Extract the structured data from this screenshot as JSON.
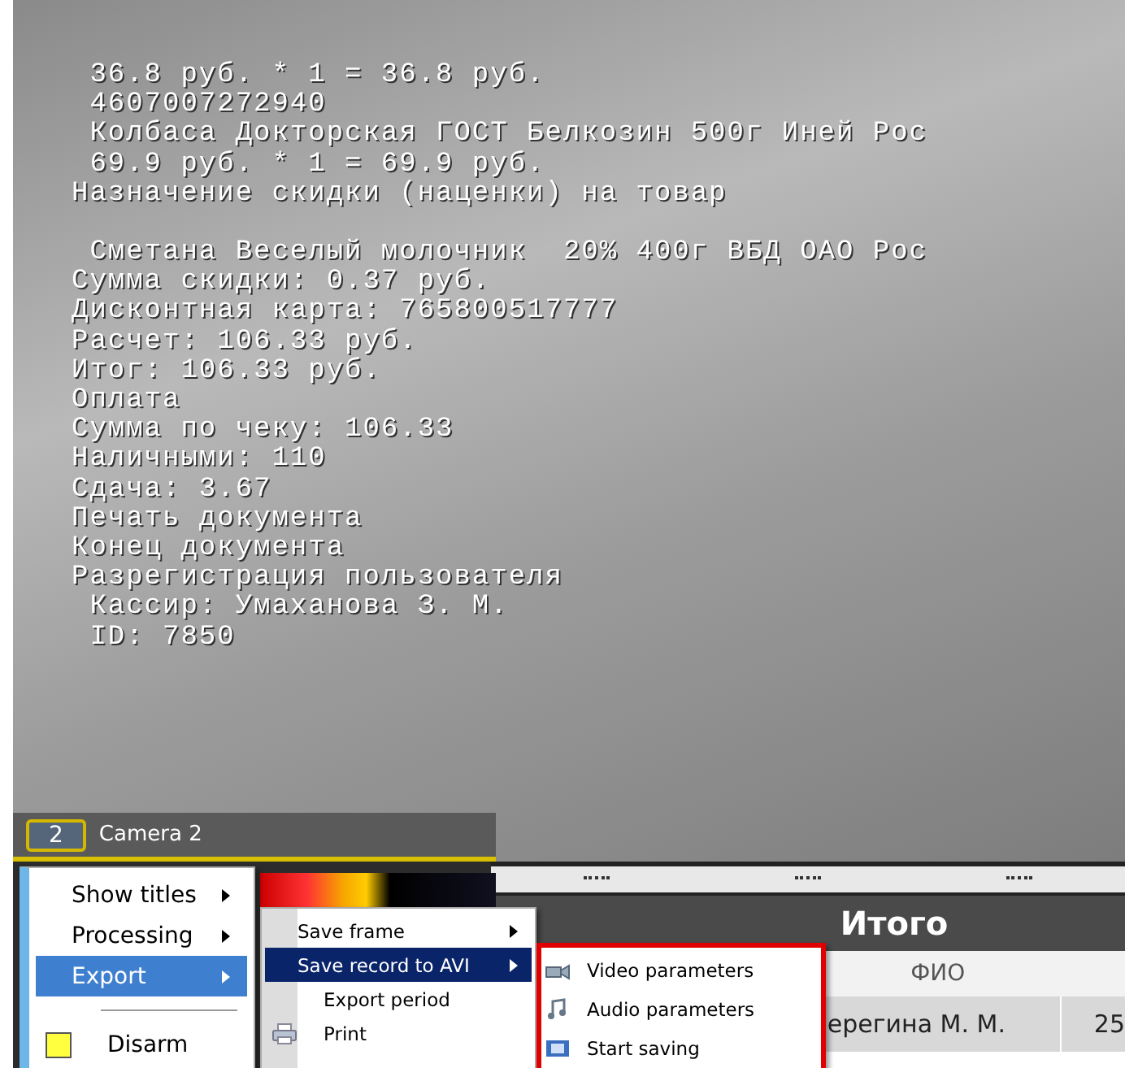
{
  "video": {
    "titles": [
      [
        " 36.8 руб. * 1 = 36.8 руб.",
        " 4607007272940",
        " Колбаса Докторская ГОСТ Белкозин 500г Иней Рос",
        " 69.9 руб. * 1 = 69.9 руб.",
        "Назначение скидки (наценки) на товар"
      ],
      [
        " Сметана Веселый молочник  20% 400г ВБД ОАО Рос",
        "Сумма скидки: 0.37 руб.",
        "Дисконтная карта: 765800517777",
        "Расчет: 106.33 руб.",
        "Итог: 106.33 руб.",
        "Оплата",
        "Сумма по чеку: 106.33",
        "Наличными: 110",
        "Сдача: 3.67",
        "Печать документа",
        "Конец документа",
        "Разрегистрация пользователя",
        " Кассир: Умаханова З. М.",
        " ID: 7850"
      ]
    ]
  },
  "camera": {
    "number": "2",
    "name": "Camera 2"
  },
  "table": {
    "title": "Итого",
    "columns": [
      "ФИО"
    ],
    "rows": [
      [
        "ерегина М. М.",
        "25"
      ]
    ]
  },
  "context_menu": {
    "items": [
      {
        "kind": "submenu",
        "label": "Show titles",
        "selected": false
      },
      {
        "kind": "submenu",
        "label": "Processing",
        "selected": false
      },
      {
        "kind": "submenu",
        "label": "Export",
        "selected": true
      },
      {
        "kind": "separator"
      },
      {
        "kind": "check",
        "label": "Disarm",
        "selected": false
      }
    ]
  },
  "export_menu": {
    "items": [
      {
        "kind": "submenu",
        "label": "Save frame",
        "selected": false
      },
      {
        "kind": "submenu",
        "label": "Save record to AVI",
        "selected": true
      },
      {
        "kind": "command",
        "label": "Export period",
        "selected": false
      },
      {
        "kind": "icon_command",
        "label": "Print",
        "selected": false
      }
    ]
  },
  "avi_menu": {
    "items": [
      {
        "label": "Video parameters"
      },
      {
        "label": "Audio parameters"
      },
      {
        "label": "Start saving"
      }
    ]
  }
}
